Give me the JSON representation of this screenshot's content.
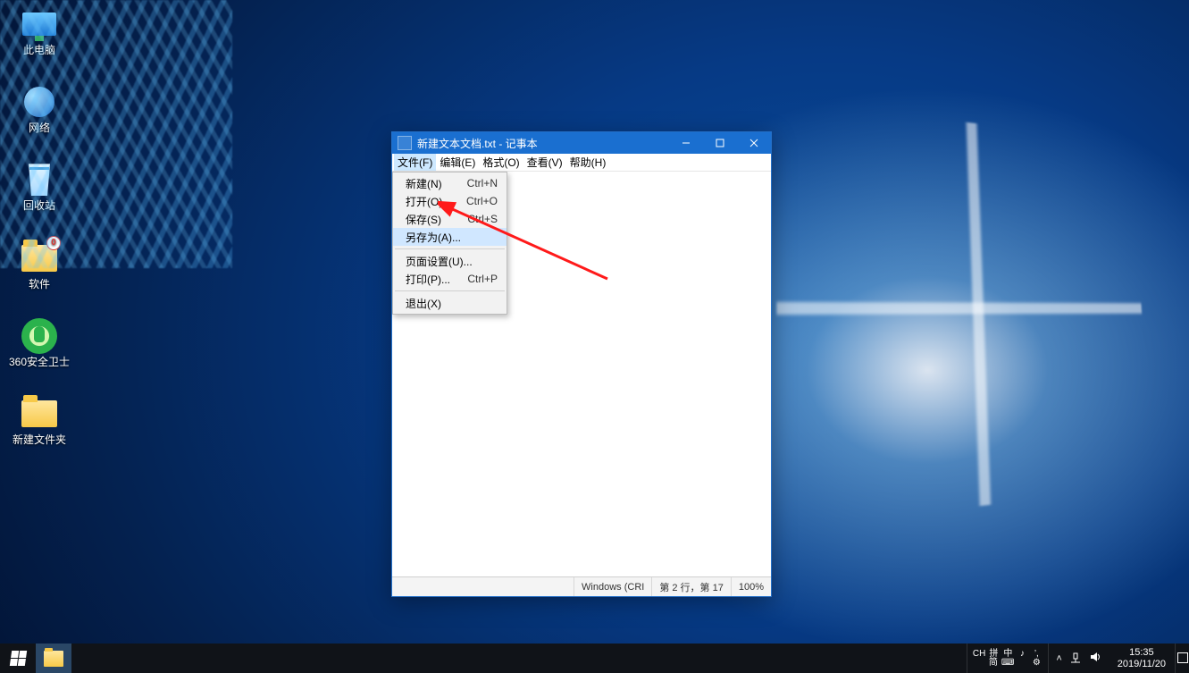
{
  "desktop_icons": [
    {
      "name": "pc",
      "label": "此电脑"
    },
    {
      "name": "network",
      "label": "网络"
    },
    {
      "name": "recycle",
      "label": "回收站"
    },
    {
      "name": "software",
      "label": "软件",
      "badge": "0"
    },
    {
      "name": "360",
      "label": "360安全卫士"
    },
    {
      "name": "newfolder",
      "label": "新建文件夹"
    }
  ],
  "notepad": {
    "title": "新建文本文档.txt - 记事本",
    "menus": {
      "file": "文件(F)",
      "edit": "编辑(E)",
      "format": "格式(O)",
      "view": "查看(V)",
      "help": "帮助(H)"
    },
    "file_menu": [
      {
        "label": "新建(N)",
        "shortcut": "Ctrl+N"
      },
      {
        "label": "打开(O)...",
        "shortcut": "Ctrl+O"
      },
      {
        "label": "保存(S)",
        "shortcut": "Ctrl+S"
      },
      {
        "label": "另存为(A)...",
        "shortcut": ""
      },
      {
        "sep": true
      },
      {
        "label": "页面设置(U)...",
        "shortcut": ""
      },
      {
        "label": "打印(P)...",
        "shortcut": "Ctrl+P"
      },
      {
        "sep": true
      },
      {
        "label": "退出(X)",
        "shortcut": ""
      }
    ],
    "status": {
      "encoding": "Windows (CRI",
      "position": "第 2 行，第 17",
      "zoom": "100%"
    }
  },
  "taskbar": {
    "ime": {
      "top": [
        "CH",
        "拼",
        "中",
        "♪",
        "’,"
      ],
      "bottom": [
        "",
        "简",
        "⌨",
        "",
        "⚙"
      ]
    },
    "tray_chevron": "˄",
    "clock": {
      "time": "15:35",
      "date": "2019/11/20"
    }
  }
}
